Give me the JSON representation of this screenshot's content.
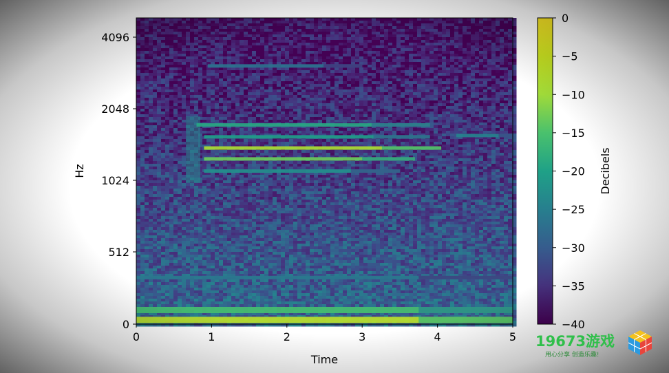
{
  "chart_data": {
    "type": "heatmap",
    "title": "",
    "xlabel": "Time",
    "ylabel": "Hz",
    "xlim": [
      0,
      5
    ],
    "ylim": [
      0,
      5200
    ],
    "y_scale": "symlog-like (linear below 512 Hz, log above)",
    "x_ticks": [
      "0",
      "1",
      "2",
      "3",
      "4",
      "5"
    ],
    "y_ticks": [
      "0",
      "512",
      "1024",
      "2048",
      "4096"
    ],
    "colormap": "viridis",
    "colorbar": {
      "label": "Decibels",
      "range": [
        -40,
        0
      ],
      "ticks": [
        "0",
        "−5",
        "−10",
        "−15",
        "−20",
        "−25",
        "−30",
        "−35",
        "−40"
      ]
    },
    "bands": [
      {
        "freq_hz": 3100,
        "t_start": 0.95,
        "t_end": 3.0,
        "level_db": -25
      },
      {
        "freq_hz": 1750,
        "t_start": 0.8,
        "t_end": 3.9,
        "level_db": -16
      },
      {
        "freq_hz": 1560,
        "t_start": 0.9,
        "t_end": 3.9,
        "level_db": -18
      },
      {
        "freq_hz": 1400,
        "t_start": 0.9,
        "t_end": 4.05,
        "level_db": -5
      },
      {
        "freq_hz": 1260,
        "t_start": 0.9,
        "t_end": 3.7,
        "level_db": -9
      },
      {
        "freq_hz": 1120,
        "t_start": 0.9,
        "t_end": 3.5,
        "level_db": -20
      },
      {
        "freq_hz": 1580,
        "t_start": 4.25,
        "t_end": 5.0,
        "level_db": -22
      },
      {
        "freq_hz": 330,
        "t_start": 0.0,
        "t_end": 5.0,
        "level_db": -24
      },
      {
        "freq_hz": 100,
        "t_start": 0.0,
        "t_end": 5.0,
        "level_db": -12
      },
      {
        "freq_hz": 30,
        "t_start": 0.0,
        "t_end": 5.0,
        "level_db": -4
      }
    ]
  },
  "watermark": {
    "title": "19673游戏",
    "subtitle": "用心分享 创造乐趣!"
  }
}
